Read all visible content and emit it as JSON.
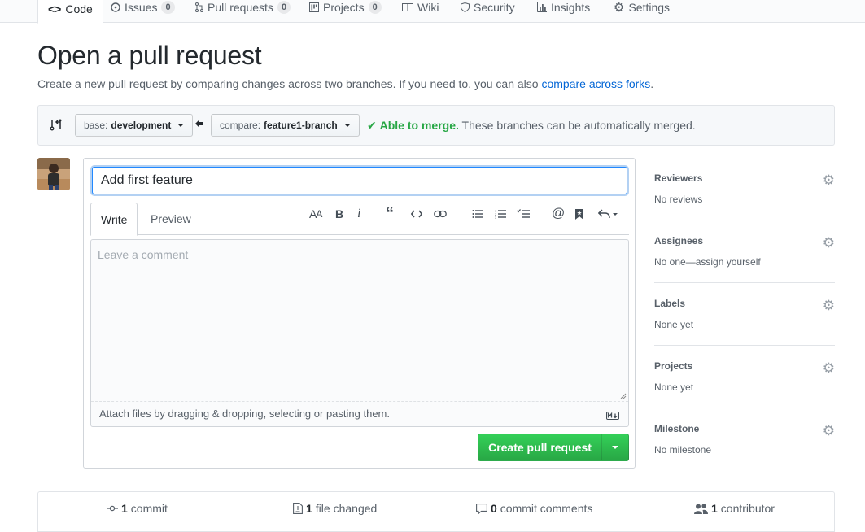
{
  "nav": {
    "tabs": [
      {
        "label": "Code",
        "icon": "code-icon"
      },
      {
        "label": "Issues",
        "count": "0",
        "icon": "issue-icon"
      },
      {
        "label": "Pull requests",
        "count": "0",
        "icon": "pull-request-icon"
      },
      {
        "label": "Projects",
        "count": "0",
        "icon": "project-icon"
      },
      {
        "label": "Wiki",
        "icon": "book-icon"
      },
      {
        "label": "Security",
        "icon": "shield-icon"
      },
      {
        "label": "Insights",
        "icon": "graph-icon"
      },
      {
        "label": "Settings",
        "icon": "gear-icon"
      }
    ]
  },
  "header": {
    "title": "Open a pull request",
    "subtitle": "Create a new pull request by comparing changes across two branches. If you need to, you can also",
    "link": "compare across forks",
    "link_suffix": "."
  },
  "range": {
    "base_prefix": "base:",
    "base_branch": "development",
    "compare_prefix": "compare:",
    "compare_branch": "feature1-branch",
    "merge_ok": "Able to merge.",
    "merge_text": "These branches can be automatically merged."
  },
  "form": {
    "title_value": "Add first feature",
    "tab_write": "Write",
    "tab_preview": "Preview",
    "comment_placeholder": "Leave a comment",
    "attach_text": "Attach files by dragging & dropping, selecting or pasting them.",
    "create_label": "Create pull request"
  },
  "sidebar": {
    "items": [
      {
        "label": "Reviewers",
        "value": "No reviews"
      },
      {
        "label": "Assignees",
        "value": "No one—assign yourself"
      },
      {
        "label": "Labels",
        "value": "None yet"
      },
      {
        "label": "Projects",
        "value": "None yet"
      },
      {
        "label": "Milestone",
        "value": "No milestone"
      }
    ]
  },
  "summary": {
    "commits_count": "1",
    "commits_label": "commit",
    "files_count": "1",
    "files_label": "file changed",
    "comments_count": "0",
    "comments_label": "commit comments",
    "contributors_count": "1",
    "contributors_label": "contributor"
  },
  "colors": {
    "accent": "#0366d6",
    "success": "#28a745",
    "tab_highlight": "#e36209"
  }
}
